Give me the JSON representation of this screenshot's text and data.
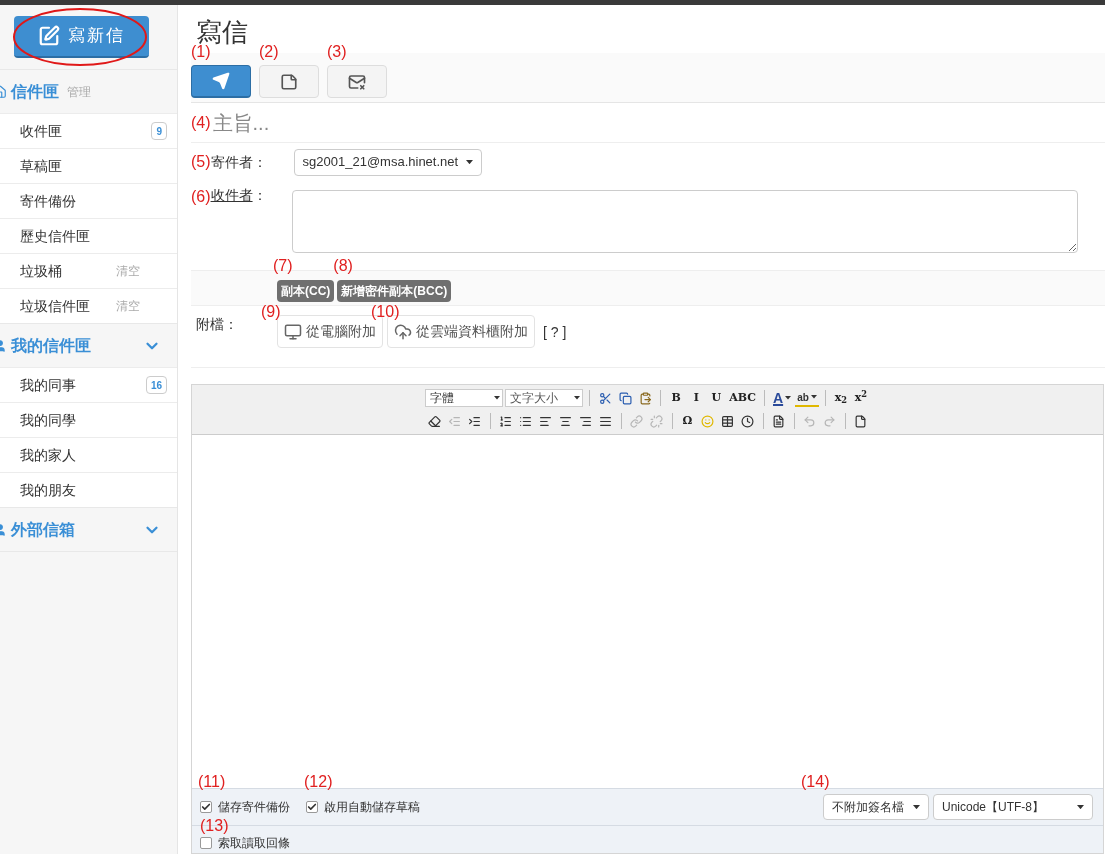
{
  "sidebar": {
    "compose_button": "寫新信",
    "sections": [
      {
        "title": "信件匣",
        "action": "管理",
        "collapsible": false,
        "items": [
          {
            "label": "收件匣",
            "count": "9"
          },
          {
            "label": "草稿匣"
          },
          {
            "label": "寄件備份"
          },
          {
            "label": "歷史信件匣"
          },
          {
            "label": "垃圾桶",
            "action": "清空"
          },
          {
            "label": "垃圾信件匣",
            "action": "清空"
          }
        ]
      },
      {
        "title": "我的信件匣",
        "collapsible": true,
        "items": [
          {
            "label": "我的同事",
            "count": "16"
          },
          {
            "label": "我的同學"
          },
          {
            "label": "我的家人"
          },
          {
            "label": "我的朋友"
          }
        ]
      },
      {
        "title": "外部信箱",
        "collapsible": true
      }
    ]
  },
  "page": {
    "title": "寫信"
  },
  "toolbar": [
    {
      "annotation": "(1)",
      "selected": true
    },
    {
      "annotation": "(2)",
      "selected": false
    },
    {
      "annotation": "(3)",
      "selected": false
    }
  ],
  "subject": {
    "annotation": "(4)",
    "placeholder": "主旨..."
  },
  "sender": {
    "annotation": "(5)",
    "label": "寄件者：",
    "value": "sg2001_21@msa.hinet.net"
  },
  "recipients": {
    "annotation": "(6)",
    "label": "收件者",
    "colon": "："
  },
  "copy_buttons": [
    {
      "annotation": "(7)",
      "label": "副本(CC)"
    },
    {
      "annotation": "(8)",
      "label": "新增密件副本(BCC)"
    }
  ],
  "attachments": {
    "label": "附檔：",
    "buttons": [
      {
        "annotation": "(9)",
        "label": "從電腦附加"
      },
      {
        "annotation": "(10)",
        "label": "從雲端資料櫃附加"
      }
    ],
    "help": "[ ? ]"
  },
  "editor": {
    "font": "字體",
    "size": "文字大小",
    "row1": [
      {
        "kind": "icon"
      },
      {
        "kind": "icon"
      },
      {
        "kind": "icon"
      },
      {
        "kind": "sep"
      },
      {
        "kind": "text",
        "label": "B"
      },
      {
        "kind": "text",
        "label": "I"
      },
      {
        "kind": "text",
        "label": "U"
      },
      {
        "kind": "text",
        "label": "ABC"
      },
      {
        "kind": "sep"
      },
      {
        "kind": "color",
        "label": "A"
      },
      {
        "kind": "highlight",
        "label": "ab"
      },
      {
        "kind": "sep"
      },
      {
        "kind": "text",
        "label": "x$_{2}$"
      },
      {
        "kind": "text",
        "label": "x$^{2}$"
      }
    ],
    "row2": [
      {
        "kind": "icon",
        "disabled": false
      },
      {
        "kind": "icon",
        "disabled": true
      },
      {
        "kind": "icon",
        "disabled": false
      },
      {
        "kind": "sep"
      },
      {
        "kind": "icon",
        "disabled": false
      },
      {
        "kind": "icon",
        "disabled": false
      },
      {
        "kind": "icon",
        "disabled": false
      },
      {
        "kind": "icon",
        "disabled": false
      },
      {
        "kind": "icon",
        "disabled": false
      },
      {
        "kind": "icon",
        "disabled": false
      },
      {
        "kind": "sep"
      },
      {
        "kind": "icon",
        "disabled": true
      },
      {
        "kind": "icon",
        "disabled": true
      },
      {
        "kind": "sep"
      },
      {
        "kind": "text",
        "label": "Ω",
        "disabled": false
      },
      {
        "kind": "icon",
        "disabled": false
      },
      {
        "kind": "icon",
        "disabled": false
      },
      {
        "kind": "icon",
        "disabled": false
      },
      {
        "kind": "sep"
      },
      {
        "kind": "icon",
        "disabled": false
      },
      {
        "kind": "sep"
      },
      {
        "kind": "icon",
        "disabled": true
      },
      {
        "kind": "icon",
        "disabled": true
      },
      {
        "kind": "sep"
      },
      {
        "kind": "icon",
        "disabled": false
      }
    ]
  },
  "options": [
    {
      "annotation": "(11)",
      "label": "儲存寄件備份",
      "checked": true
    },
    {
      "annotation": "(12)",
      "label": "啟用自動儲存草稿",
      "checked": true
    }
  ],
  "signature": {
    "annotation": "(14)",
    "value": "不附加簽名檔"
  },
  "encoding": {
    "value": "Unicode【UTF-8】"
  },
  "receipt": {
    "annotation": "(13)",
    "label": "索取讀取回條",
    "checked": false
  }
}
